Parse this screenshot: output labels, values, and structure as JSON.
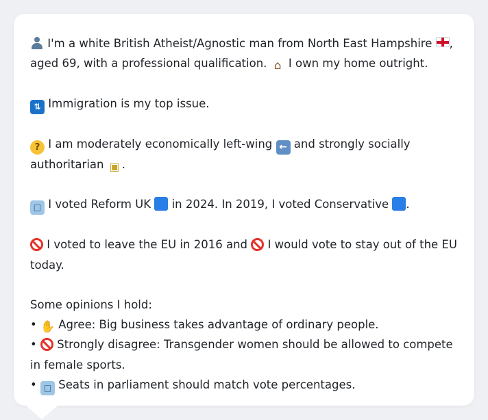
{
  "profile": {
    "line1_a": "I'm a white British Atheist/Agnostic man from North East Hampshire",
    "line1_b": ",",
    "line2_a": "aged 69, with a professional qualification.",
    "line2_b": "I own my home outright.",
    "immigration": "Immigration is my top issue.",
    "econ_a": "I am moderately economically left-wing",
    "econ_b": "and strongly socially",
    "econ_c": "authoritarian",
    "econ_d": ".",
    "vote_a": "I voted Reform UK",
    "vote_b": "in 2024. In 2019, I voted Conservative",
    "vote_c": ".",
    "eu_a": "I voted to leave the EU in 2016 and",
    "eu_b": "I would vote to stay out of the EU",
    "eu_c": "today.",
    "opinions_heading": "Some opinions I hold:",
    "opinion1": "Agree: Big business takes advantage of ordinary people.",
    "opinion2_a": "Strongly disagree: Transgender women should be allowed to compete",
    "opinion2_b": "in female sports.",
    "opinion3": "Seats in parliament should match vote percentages.",
    "bullet": "•"
  },
  "icons": {
    "person": "person-icon",
    "england_flag": "england-flag-icon",
    "house": "house-icon",
    "passport_control": "passport-control-icon",
    "thinking": "thinking-face-icon",
    "left_arrow": "left-arrow-icon",
    "lock": "lock-icon",
    "ballot_box": "ballot-box-icon",
    "blue_square": "blue-square-icon",
    "prohibited": "prohibited-icon",
    "thumbs_up": "thumbs-up-icon"
  },
  "colors": {
    "background": "#eef0f4",
    "card": "#ffffff",
    "text": "#1f2328",
    "party_blue": "#2a7ee8",
    "prohibited_red": "#e5332a"
  }
}
